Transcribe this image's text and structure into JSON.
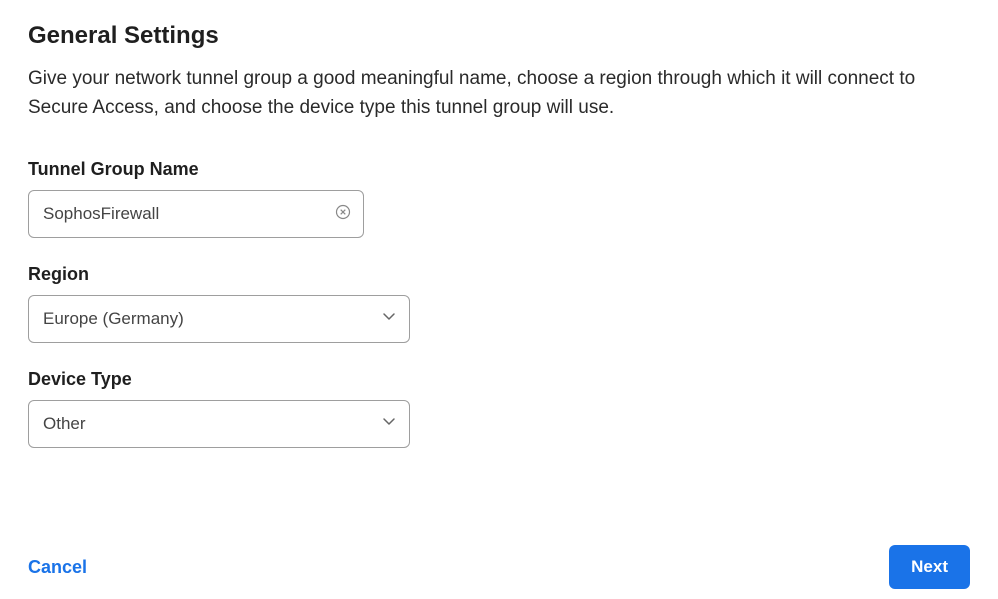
{
  "header": {
    "title": "General Settings",
    "description": "Give your network tunnel group a good meaningful name, choose a region through which it will connect to Secure Access, and choose the device type this tunnel group will use."
  },
  "form": {
    "tunnel_group": {
      "label": "Tunnel Group Name",
      "value": "SophosFirewall"
    },
    "region": {
      "label": "Region",
      "value": "Europe (Germany)"
    },
    "device_type": {
      "label": "Device Type",
      "value": "Other"
    }
  },
  "footer": {
    "cancel_label": "Cancel",
    "next_label": "Next"
  }
}
